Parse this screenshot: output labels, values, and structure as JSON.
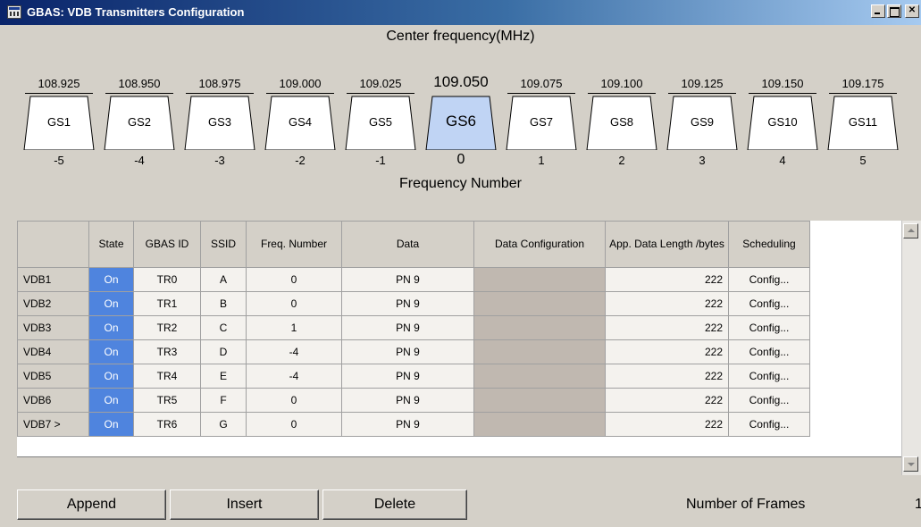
{
  "window": {
    "title": "GBAS: VDB Transmitters Configuration",
    "controls": [
      "minimize",
      "maximize",
      "close"
    ]
  },
  "spectrum": {
    "center_label": "Center frequency(MHz)",
    "freq_number_label": "Frequency Number",
    "active_index": 5,
    "stations": [
      {
        "freq": "108.925",
        "label": "GS1",
        "num": "-5"
      },
      {
        "freq": "108.950",
        "label": "GS2",
        "num": "-4"
      },
      {
        "freq": "108.975",
        "label": "GS3",
        "num": "-3"
      },
      {
        "freq": "109.000",
        "label": "GS4",
        "num": "-2"
      },
      {
        "freq": "109.025",
        "label": "GS5",
        "num": "-1"
      },
      {
        "freq": "109.050",
        "label": "GS6",
        "num": "0"
      },
      {
        "freq": "109.075",
        "label": "GS7",
        "num": "1"
      },
      {
        "freq": "109.100",
        "label": "GS8",
        "num": "2"
      },
      {
        "freq": "109.125",
        "label": "GS9",
        "num": "3"
      },
      {
        "freq": "109.150",
        "label": "GS10",
        "num": "4"
      },
      {
        "freq": "109.175",
        "label": "GS11",
        "num": "5"
      }
    ]
  },
  "table": {
    "headers": [
      "",
      "State",
      "GBAS ID",
      "SSID",
      "Freq. Number",
      "Data",
      "Data Configuration",
      "App. Data Length /bytes",
      "Scheduling"
    ],
    "rows": [
      {
        "name": "VDB1",
        "state": "On",
        "gbas_id": "TR0",
        "ssid": "A",
        "freq_number": "0",
        "data": "PN 9",
        "data_config": "",
        "length": "222",
        "scheduling": "Config..."
      },
      {
        "name": "VDB2",
        "state": "On",
        "gbas_id": "TR1",
        "ssid": "B",
        "freq_number": "0",
        "data": "PN 9",
        "data_config": "",
        "length": "222",
        "scheduling": "Config..."
      },
      {
        "name": "VDB3",
        "state": "On",
        "gbas_id": "TR2",
        "ssid": "C",
        "freq_number": "1",
        "data": "PN 9",
        "data_config": "",
        "length": "222",
        "scheduling": "Config..."
      },
      {
        "name": "VDB4",
        "state": "On",
        "gbas_id": "TR3",
        "ssid": "D",
        "freq_number": "-4",
        "data": "PN 9",
        "data_config": "",
        "length": "222",
        "scheduling": "Config..."
      },
      {
        "name": "VDB5",
        "state": "On",
        "gbas_id": "TR4",
        "ssid": "E",
        "freq_number": "-4",
        "data": "PN 9",
        "data_config": "",
        "length": "222",
        "scheduling": "Config..."
      },
      {
        "name": "VDB6",
        "state": "On",
        "gbas_id": "TR5",
        "ssid": "F",
        "freq_number": "0",
        "data": "PN 9",
        "data_config": "",
        "length": "222",
        "scheduling": "Config..."
      },
      {
        "name": "VDB7 >",
        "state": "On",
        "gbas_id": "TR6",
        "ssid": "G",
        "freq_number": "0",
        "data": "PN 9",
        "data_config": "",
        "length": "222",
        "scheduling": "Config..."
      }
    ]
  },
  "buttons": {
    "append": "Append",
    "insert": "Insert",
    "delete": "Delete"
  },
  "frames": {
    "label": "Number of Frames",
    "value": "1"
  },
  "colors": {
    "titlebar_start": "#0a246a",
    "titlebar_end": "#a6caf0",
    "state_on": "#4f84de",
    "active_station": "#c0d4f4",
    "data_config": "#c0b8b0",
    "window_bg": "#d4d0c8"
  }
}
